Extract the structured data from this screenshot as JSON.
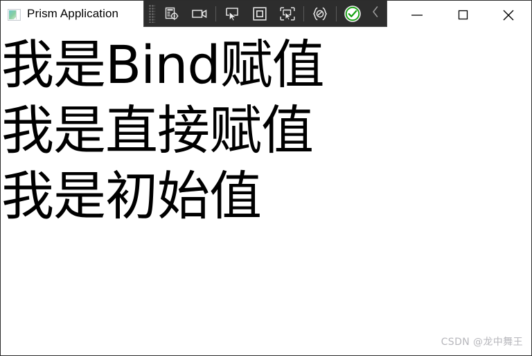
{
  "window": {
    "title": "Prism Application",
    "app_icon": "window-gradient-icon",
    "border_color": "#2b2b2b",
    "background": "#ffffff"
  },
  "titlebar": {
    "minimize_label": "—",
    "maximize_label": "□",
    "close_label": "✕",
    "buttons": [
      {
        "name": "minimize-button",
        "icon": "minimize-icon"
      },
      {
        "name": "maximize-button",
        "icon": "maximize-icon"
      },
      {
        "name": "close-button",
        "icon": "close-icon"
      }
    ]
  },
  "vs_toolbar": {
    "background": "#2d2d2d",
    "border": "#4a4a4a",
    "grip": "drag-grip-dots",
    "items": [
      {
        "name": "go-to-live-visual-tree-icon",
        "tooltip": "Go to Live Visual Tree"
      },
      {
        "name": "video-camera-icon",
        "tooltip": "Track Focused Element"
      },
      {
        "name": "select-element-icon",
        "tooltip": "Enable selection"
      },
      {
        "name": "display-layout-adorners-icon",
        "tooltip": "Display layout adorners"
      },
      {
        "name": "preview-selection-icon",
        "tooltip": "Preview selection"
      },
      {
        "name": "xaml-hot-reload-icon",
        "tooltip": "XAML Hot Reload"
      },
      {
        "name": "hot-reload-enabled-icon",
        "tooltip": "Hot Reload enabled",
        "accent": "#13a10e"
      },
      {
        "name": "collapse-toolbar-chevron-icon",
        "tooltip": "Collapse"
      }
    ]
  },
  "content": {
    "lines": [
      "我是Bind赋值",
      "我是直接赋值",
      "我是初始值"
    ]
  },
  "watermark": {
    "text": "CSDN @龙中舞王",
    "color": "#b6b6bb"
  }
}
